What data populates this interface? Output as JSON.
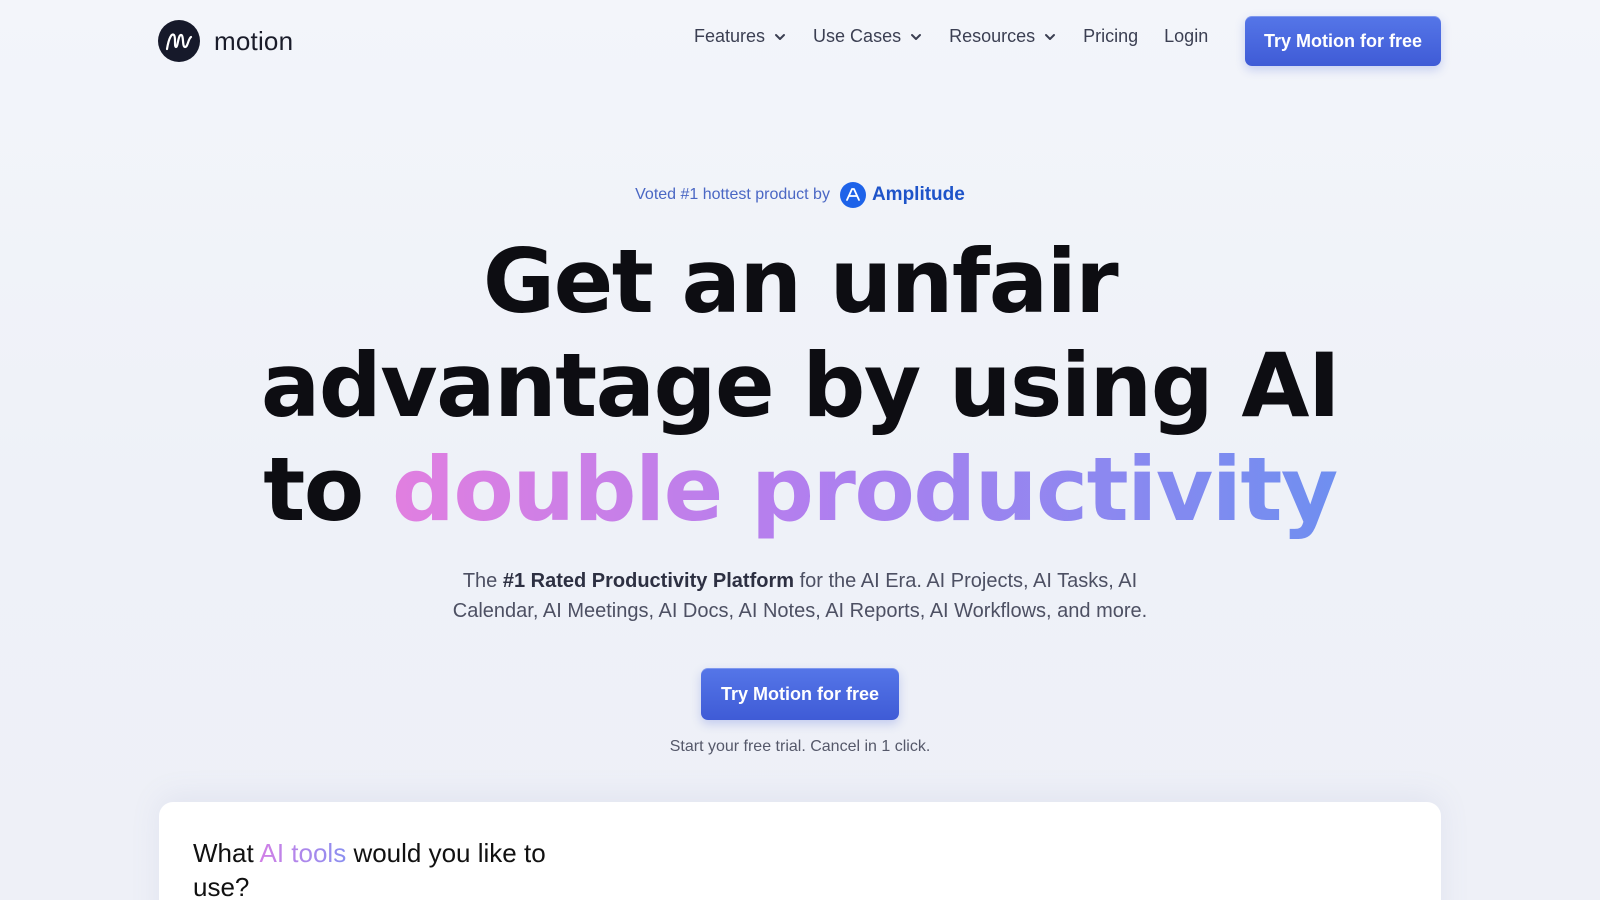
{
  "nav": {
    "brand": "motion",
    "items": [
      {
        "label": "Features"
      },
      {
        "label": "Use Cases"
      },
      {
        "label": "Resources"
      },
      {
        "label": "Pricing"
      },
      {
        "label": "Login"
      }
    ],
    "cta_label": "Try Motion for free"
  },
  "hero": {
    "voted_prefix": "Voted #1 hottest product by",
    "voted_brand": "Amplitude",
    "headline": {
      "line1": "Get an unfair",
      "line2": "advantage by using AI",
      "line3_prefix": "to",
      "line3_highlight": "double productivity"
    },
    "sub": {
      "lead": "The",
      "bold": "#1 Rated Productivity Platform",
      "rest_line1": "for the AI Era. AI Projects, AI Tasks, AI",
      "line2": "Calendar, AI Meetings, AI Docs, AI Notes, AI Reports, AI Workflows, and more."
    },
    "cta_label": "Try Motion for free",
    "trial_note": "Start your free trial. Cancel in 1 click."
  },
  "card": {
    "title_prefix": "What",
    "title_highlight": "AI tools",
    "title_suffix": "would you like to use?"
  },
  "colors": {
    "accent": "#4a68dc",
    "gradient_start": "#e17fe0",
    "gradient_end": "#6f8ff0",
    "amplitude_blue": "#1e63e9"
  }
}
